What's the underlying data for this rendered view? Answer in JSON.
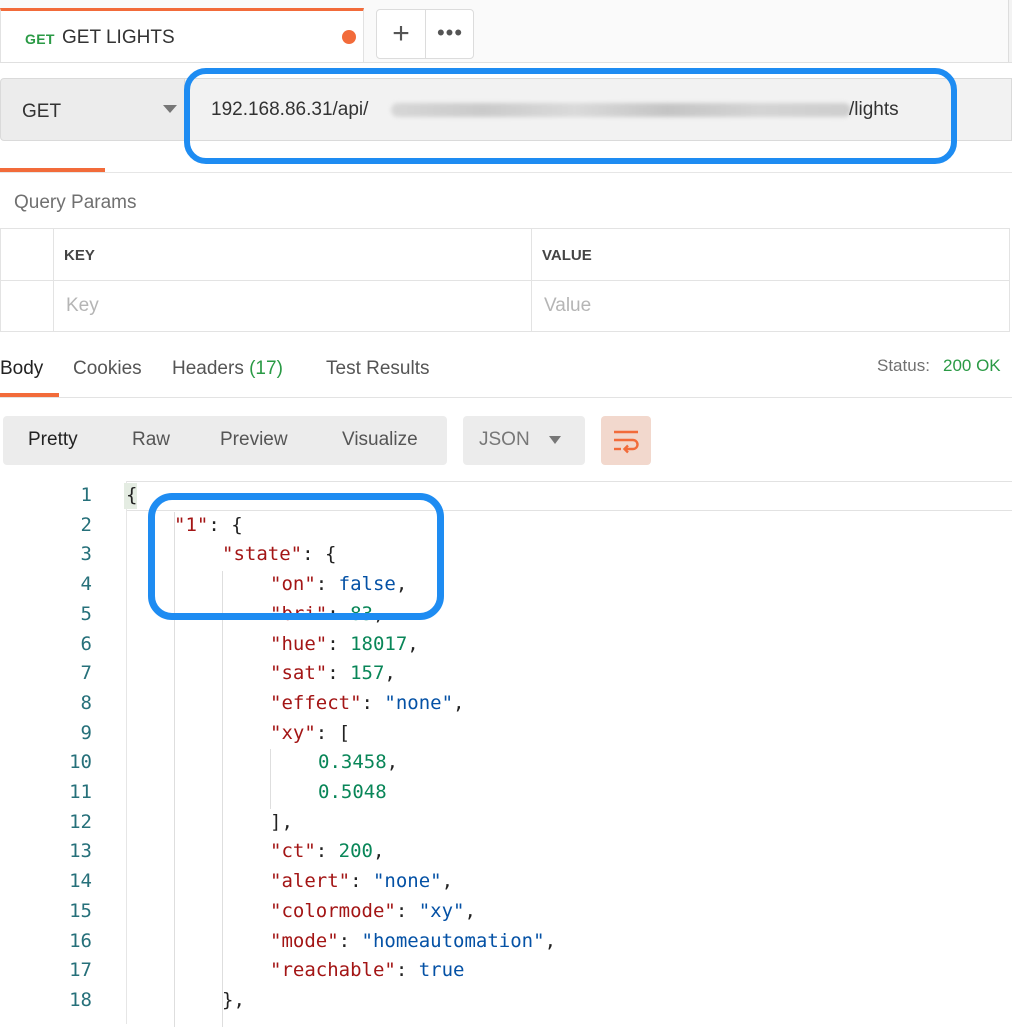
{
  "request_tab": {
    "method": "GET",
    "title": "GET LIGHTS"
  },
  "tab_actions": {
    "new_tab": "+",
    "more": "•••"
  },
  "request": {
    "method": "GET",
    "url_prefix": "192.168.86.31/api/",
    "url_suffix": "/lights"
  },
  "params": {
    "title": "Query Params",
    "key_header": "KEY",
    "value_header": "VALUE",
    "key_placeholder": "Key",
    "value_placeholder": "Value"
  },
  "response_tabs": {
    "body": "Body",
    "cookies": "Cookies",
    "headers": "Headers",
    "headers_count": "(17)",
    "test_results": "Test Results"
  },
  "status": {
    "label": "Status:",
    "value": "200 OK"
  },
  "view_modes": [
    "Pretty",
    "Raw",
    "Preview",
    "Visualize"
  ],
  "format": "JSON",
  "code": {
    "line_numbers": [
      "1",
      "2",
      "3",
      "4",
      "5",
      "6",
      "7",
      "8",
      "9",
      "10",
      "11",
      "12",
      "13",
      "14",
      "15",
      "16",
      "17",
      "18"
    ],
    "lines": [
      {
        "parts": [
          {
            "t": "{",
            "c": "p"
          }
        ]
      },
      {
        "parts": [
          {
            "t": "\"1\"",
            "c": "k"
          },
          {
            "t": ": {",
            "c": "p"
          }
        ]
      },
      {
        "parts": [
          {
            "t": "\"state\"",
            "c": "k"
          },
          {
            "t": ": {",
            "c": "p"
          }
        ]
      },
      {
        "parts": [
          {
            "t": "\"on\"",
            "c": "k"
          },
          {
            "t": ": ",
            "c": "p"
          },
          {
            "t": "false",
            "c": "b"
          },
          {
            "t": ",",
            "c": "p"
          }
        ]
      },
      {
        "parts": [
          {
            "t": "\"bri\"",
            "c": "k"
          },
          {
            "t": ": ",
            "c": "p"
          },
          {
            "t": "83",
            "c": "n"
          },
          {
            "t": ",",
            "c": "p"
          }
        ]
      },
      {
        "parts": [
          {
            "t": "\"hue\"",
            "c": "k"
          },
          {
            "t": ": ",
            "c": "p"
          },
          {
            "t": "18017",
            "c": "n"
          },
          {
            "t": ",",
            "c": "p"
          }
        ]
      },
      {
        "parts": [
          {
            "t": "\"sat\"",
            "c": "k"
          },
          {
            "t": ": ",
            "c": "p"
          },
          {
            "t": "157",
            "c": "n"
          },
          {
            "t": ",",
            "c": "p"
          }
        ]
      },
      {
        "parts": [
          {
            "t": "\"effect\"",
            "c": "k"
          },
          {
            "t": ": ",
            "c": "p"
          },
          {
            "t": "\"none\"",
            "c": "s"
          },
          {
            "t": ",",
            "c": "p"
          }
        ]
      },
      {
        "parts": [
          {
            "t": "\"xy\"",
            "c": "k"
          },
          {
            "t": ": [",
            "c": "p"
          }
        ]
      },
      {
        "parts": [
          {
            "t": "0.3458",
            "c": "n"
          },
          {
            "t": ",",
            "c": "p"
          }
        ]
      },
      {
        "parts": [
          {
            "t": "0.5048",
            "c": "n"
          }
        ]
      },
      {
        "parts": [
          {
            "t": "],",
            "c": "p"
          }
        ]
      },
      {
        "parts": [
          {
            "t": "\"ct\"",
            "c": "k"
          },
          {
            "t": ": ",
            "c": "p"
          },
          {
            "t": "200",
            "c": "n"
          },
          {
            "t": ",",
            "c": "p"
          }
        ]
      },
      {
        "parts": [
          {
            "t": "\"alert\"",
            "c": "k"
          },
          {
            "t": ": ",
            "c": "p"
          },
          {
            "t": "\"none\"",
            "c": "s"
          },
          {
            "t": ",",
            "c": "p"
          }
        ]
      },
      {
        "parts": [
          {
            "t": "\"colormode\"",
            "c": "k"
          },
          {
            "t": ": ",
            "c": "p"
          },
          {
            "t": "\"xy\"",
            "c": "s"
          },
          {
            "t": ",",
            "c": "p"
          }
        ]
      },
      {
        "parts": [
          {
            "t": "\"mode\"",
            "c": "k"
          },
          {
            "t": ": ",
            "c": "p"
          },
          {
            "t": "\"homeautomation\"",
            "c": "s"
          },
          {
            "t": ",",
            "c": "p"
          }
        ]
      },
      {
        "parts": [
          {
            "t": "\"reachable\"",
            "c": "k"
          },
          {
            "t": ": ",
            "c": "p"
          },
          {
            "t": "true",
            "c": "b"
          }
        ]
      },
      {
        "parts": [
          {
            "t": "},",
            "c": "p"
          }
        ]
      }
    ],
    "indent_levels": [
      0,
      1,
      2,
      3,
      3,
      3,
      3,
      3,
      3,
      4,
      4,
      3,
      3,
      3,
      3,
      3,
      3,
      2
    ]
  },
  "colors": {
    "accent": "#f26b3a",
    "success": "#2a9a45",
    "annotation": "#1e8cf2",
    "json_key": "#a31515",
    "json_string": "#0451a5",
    "json_number": "#098658",
    "line_number": "#26707a"
  },
  "icons": [
    "plus-icon",
    "more-icon",
    "chevron-down-icon",
    "wrap-lines-icon"
  ]
}
